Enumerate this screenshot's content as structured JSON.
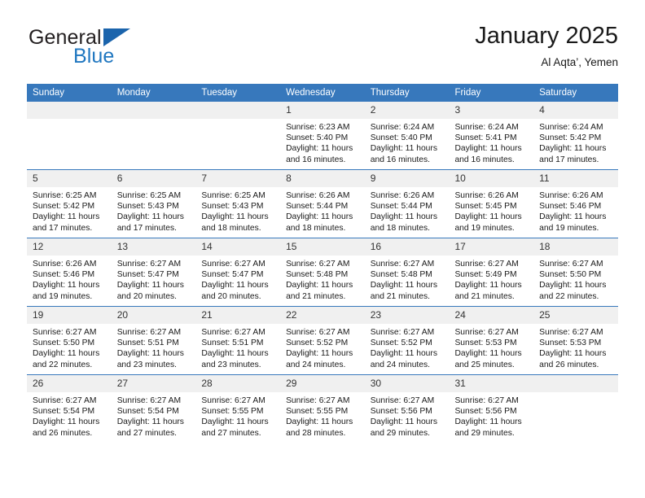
{
  "brand": {
    "name_part1": "General",
    "name_part2": "Blue",
    "logo_icon": "triangle-flag-icon",
    "accent_color": "#2077c0",
    "triangle_color": "#1b64ac"
  },
  "header": {
    "title": "January 2025",
    "subtitle": "Al Aqta’, Yemen"
  },
  "calendar": {
    "header_bg": "#3778bc",
    "daynum_bg": "#f0f0f0",
    "weekday_headers": [
      "Sunday",
      "Monday",
      "Tuesday",
      "Wednesday",
      "Thursday",
      "Friday",
      "Saturday"
    ],
    "weeks": [
      [
        {
          "day": "",
          "empty": true
        },
        {
          "day": "",
          "empty": true
        },
        {
          "day": "",
          "empty": true
        },
        {
          "day": "1",
          "sunrise": "Sunrise: 6:23 AM",
          "sunset": "Sunset: 5:40 PM",
          "daylight": "Daylight: 11 hours and 16 minutes."
        },
        {
          "day": "2",
          "sunrise": "Sunrise: 6:24 AM",
          "sunset": "Sunset: 5:40 PM",
          "daylight": "Daylight: 11 hours and 16 minutes."
        },
        {
          "day": "3",
          "sunrise": "Sunrise: 6:24 AM",
          "sunset": "Sunset: 5:41 PM",
          "daylight": "Daylight: 11 hours and 16 minutes."
        },
        {
          "day": "4",
          "sunrise": "Sunrise: 6:24 AM",
          "sunset": "Sunset: 5:42 PM",
          "daylight": "Daylight: 11 hours and 17 minutes."
        }
      ],
      [
        {
          "day": "5",
          "sunrise": "Sunrise: 6:25 AM",
          "sunset": "Sunset: 5:42 PM",
          "daylight": "Daylight: 11 hours and 17 minutes."
        },
        {
          "day": "6",
          "sunrise": "Sunrise: 6:25 AM",
          "sunset": "Sunset: 5:43 PM",
          "daylight": "Daylight: 11 hours and 17 minutes."
        },
        {
          "day": "7",
          "sunrise": "Sunrise: 6:25 AM",
          "sunset": "Sunset: 5:43 PM",
          "daylight": "Daylight: 11 hours and 18 minutes."
        },
        {
          "day": "8",
          "sunrise": "Sunrise: 6:26 AM",
          "sunset": "Sunset: 5:44 PM",
          "daylight": "Daylight: 11 hours and 18 minutes."
        },
        {
          "day": "9",
          "sunrise": "Sunrise: 6:26 AM",
          "sunset": "Sunset: 5:44 PM",
          "daylight": "Daylight: 11 hours and 18 minutes."
        },
        {
          "day": "10",
          "sunrise": "Sunrise: 6:26 AM",
          "sunset": "Sunset: 5:45 PM",
          "daylight": "Daylight: 11 hours and 19 minutes."
        },
        {
          "day": "11",
          "sunrise": "Sunrise: 6:26 AM",
          "sunset": "Sunset: 5:46 PM",
          "daylight": "Daylight: 11 hours and 19 minutes."
        }
      ],
      [
        {
          "day": "12",
          "sunrise": "Sunrise: 6:26 AM",
          "sunset": "Sunset: 5:46 PM",
          "daylight": "Daylight: 11 hours and 19 minutes."
        },
        {
          "day": "13",
          "sunrise": "Sunrise: 6:27 AM",
          "sunset": "Sunset: 5:47 PM",
          "daylight": "Daylight: 11 hours and 20 minutes."
        },
        {
          "day": "14",
          "sunrise": "Sunrise: 6:27 AM",
          "sunset": "Sunset: 5:47 PM",
          "daylight": "Daylight: 11 hours and 20 minutes."
        },
        {
          "day": "15",
          "sunrise": "Sunrise: 6:27 AM",
          "sunset": "Sunset: 5:48 PM",
          "daylight": "Daylight: 11 hours and 21 minutes."
        },
        {
          "day": "16",
          "sunrise": "Sunrise: 6:27 AM",
          "sunset": "Sunset: 5:48 PM",
          "daylight": "Daylight: 11 hours and 21 minutes."
        },
        {
          "day": "17",
          "sunrise": "Sunrise: 6:27 AM",
          "sunset": "Sunset: 5:49 PM",
          "daylight": "Daylight: 11 hours and 21 minutes."
        },
        {
          "day": "18",
          "sunrise": "Sunrise: 6:27 AM",
          "sunset": "Sunset: 5:50 PM",
          "daylight": "Daylight: 11 hours and 22 minutes."
        }
      ],
      [
        {
          "day": "19",
          "sunrise": "Sunrise: 6:27 AM",
          "sunset": "Sunset: 5:50 PM",
          "daylight": "Daylight: 11 hours and 22 minutes."
        },
        {
          "day": "20",
          "sunrise": "Sunrise: 6:27 AM",
          "sunset": "Sunset: 5:51 PM",
          "daylight": "Daylight: 11 hours and 23 minutes."
        },
        {
          "day": "21",
          "sunrise": "Sunrise: 6:27 AM",
          "sunset": "Sunset: 5:51 PM",
          "daylight": "Daylight: 11 hours and 23 minutes."
        },
        {
          "day": "22",
          "sunrise": "Sunrise: 6:27 AM",
          "sunset": "Sunset: 5:52 PM",
          "daylight": "Daylight: 11 hours and 24 minutes."
        },
        {
          "day": "23",
          "sunrise": "Sunrise: 6:27 AM",
          "sunset": "Sunset: 5:52 PM",
          "daylight": "Daylight: 11 hours and 24 minutes."
        },
        {
          "day": "24",
          "sunrise": "Sunrise: 6:27 AM",
          "sunset": "Sunset: 5:53 PM",
          "daylight": "Daylight: 11 hours and 25 minutes."
        },
        {
          "day": "25",
          "sunrise": "Sunrise: 6:27 AM",
          "sunset": "Sunset: 5:53 PM",
          "daylight": "Daylight: 11 hours and 26 minutes."
        }
      ],
      [
        {
          "day": "26",
          "sunrise": "Sunrise: 6:27 AM",
          "sunset": "Sunset: 5:54 PM",
          "daylight": "Daylight: 11 hours and 26 minutes."
        },
        {
          "day": "27",
          "sunrise": "Sunrise: 6:27 AM",
          "sunset": "Sunset: 5:54 PM",
          "daylight": "Daylight: 11 hours and 27 minutes."
        },
        {
          "day": "28",
          "sunrise": "Sunrise: 6:27 AM",
          "sunset": "Sunset: 5:55 PM",
          "daylight": "Daylight: 11 hours and 27 minutes."
        },
        {
          "day": "29",
          "sunrise": "Sunrise: 6:27 AM",
          "sunset": "Sunset: 5:55 PM",
          "daylight": "Daylight: 11 hours and 28 minutes."
        },
        {
          "day": "30",
          "sunrise": "Sunrise: 6:27 AM",
          "sunset": "Sunset: 5:56 PM",
          "daylight": "Daylight: 11 hours and 29 minutes."
        },
        {
          "day": "31",
          "sunrise": "Sunrise: 6:27 AM",
          "sunset": "Sunset: 5:56 PM",
          "daylight": "Daylight: 11 hours and 29 minutes."
        },
        {
          "day": "",
          "empty": true
        }
      ]
    ]
  }
}
